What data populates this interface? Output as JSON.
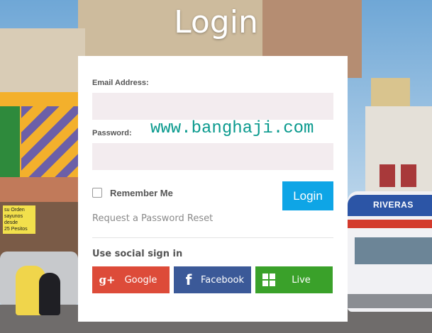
{
  "page": {
    "title": "Login"
  },
  "form": {
    "email_label": "Email Address:",
    "email_value": "",
    "password_label": "Password:",
    "password_value": "",
    "remember_label": "Remember Me",
    "remember_checked": false,
    "login_button": "Login",
    "reset_link": "Request a Password Reset"
  },
  "social": {
    "heading": "Use social sign in",
    "buttons": [
      {
        "label": "Google",
        "icon": "google-plus-icon",
        "color": "#dd4b39"
      },
      {
        "label": "Facebook",
        "icon": "facebook-icon",
        "color": "#3b5998"
      },
      {
        "label": "Live",
        "icon": "windows-icon",
        "color": "#3aa12a"
      }
    ]
  },
  "background": {
    "bus_sign": "RIVERAS",
    "store_sign": "su Orden\nsayunos desde\n25 Pesitos"
  },
  "watermark": "www.banghaji.com",
  "colors": {
    "accent": "#0ea5e6",
    "field_bg": "#f3ecef"
  }
}
